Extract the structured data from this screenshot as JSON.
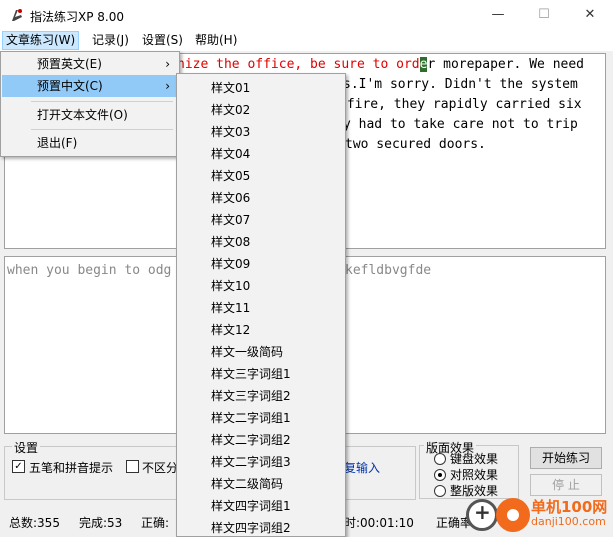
{
  "window": {
    "title": "指法练习XP 8.00",
    "minimize": "—",
    "maximize": "☐",
    "close": "✕"
  },
  "menubar": {
    "items": [
      "文章练习(W)",
      "记录(J)",
      "设置(S)",
      "帮助(H)"
    ]
  },
  "source": {
    "line1": {
      "prefix": " ",
      "done": "nize the office, be sure to ord",
      "cursor": "e",
      "rest": "r morepaper. We need"
    },
    "line2": "s.I'm sorry. Didn't the system",
    "line3": " fire, they rapidly carried six",
    "line4": "y had to take care not to trip",
    "line5": "two secured doors."
  },
  "input": {
    "left": "when you begin to odg",
    "right": "kefldbvgfde"
  },
  "settings": {
    "legend": "设置",
    "wubi_label": "五笔和拼音提示",
    "wubi_checked": true,
    "nocase_label": "不区分",
    "nocase_checked": false,
    "input_link": "复输入"
  },
  "layout": {
    "legend": "版面效果",
    "options": [
      "键盘效果",
      "对照效果",
      "整版效果"
    ],
    "selected": 1
  },
  "buttons": {
    "start": "开始练习",
    "stop": "停 止"
  },
  "status": {
    "total": "总数:355",
    "done": "完成:53",
    "correct": "正确:",
    "time": "时:00:01:10",
    "rate": "正确率:38"
  },
  "menu_article": {
    "items": [
      {
        "label": "预置英文(E)",
        "arrow": "›"
      },
      {
        "label": "预置中文(C)",
        "arrow": "›"
      },
      {
        "label": "打开文本文件(O)"
      },
      {
        "label": "退出(F)"
      }
    ]
  },
  "menu_chinese": {
    "items": [
      "样文01",
      "样文02",
      "样文03",
      "样文04",
      "样文05",
      "样文06",
      "样文07",
      "样文08",
      "样文09",
      "样文10",
      "样文11",
      "样文12",
      "样文一级简码",
      "样文三字词组1",
      "样文三字词组2",
      "样文二字词组1",
      "样文二字词组2",
      "样文二字词组3",
      "样文二级简码",
      "样文四字词组1",
      "样文四字词组2"
    ]
  },
  "watermark": {
    "name": "单机100网",
    "url": "danji100.com"
  },
  "colors": {
    "done_text": "#e00000",
    "menu_highlight": "#91c9f7",
    "brand": "#f26a1b"
  }
}
